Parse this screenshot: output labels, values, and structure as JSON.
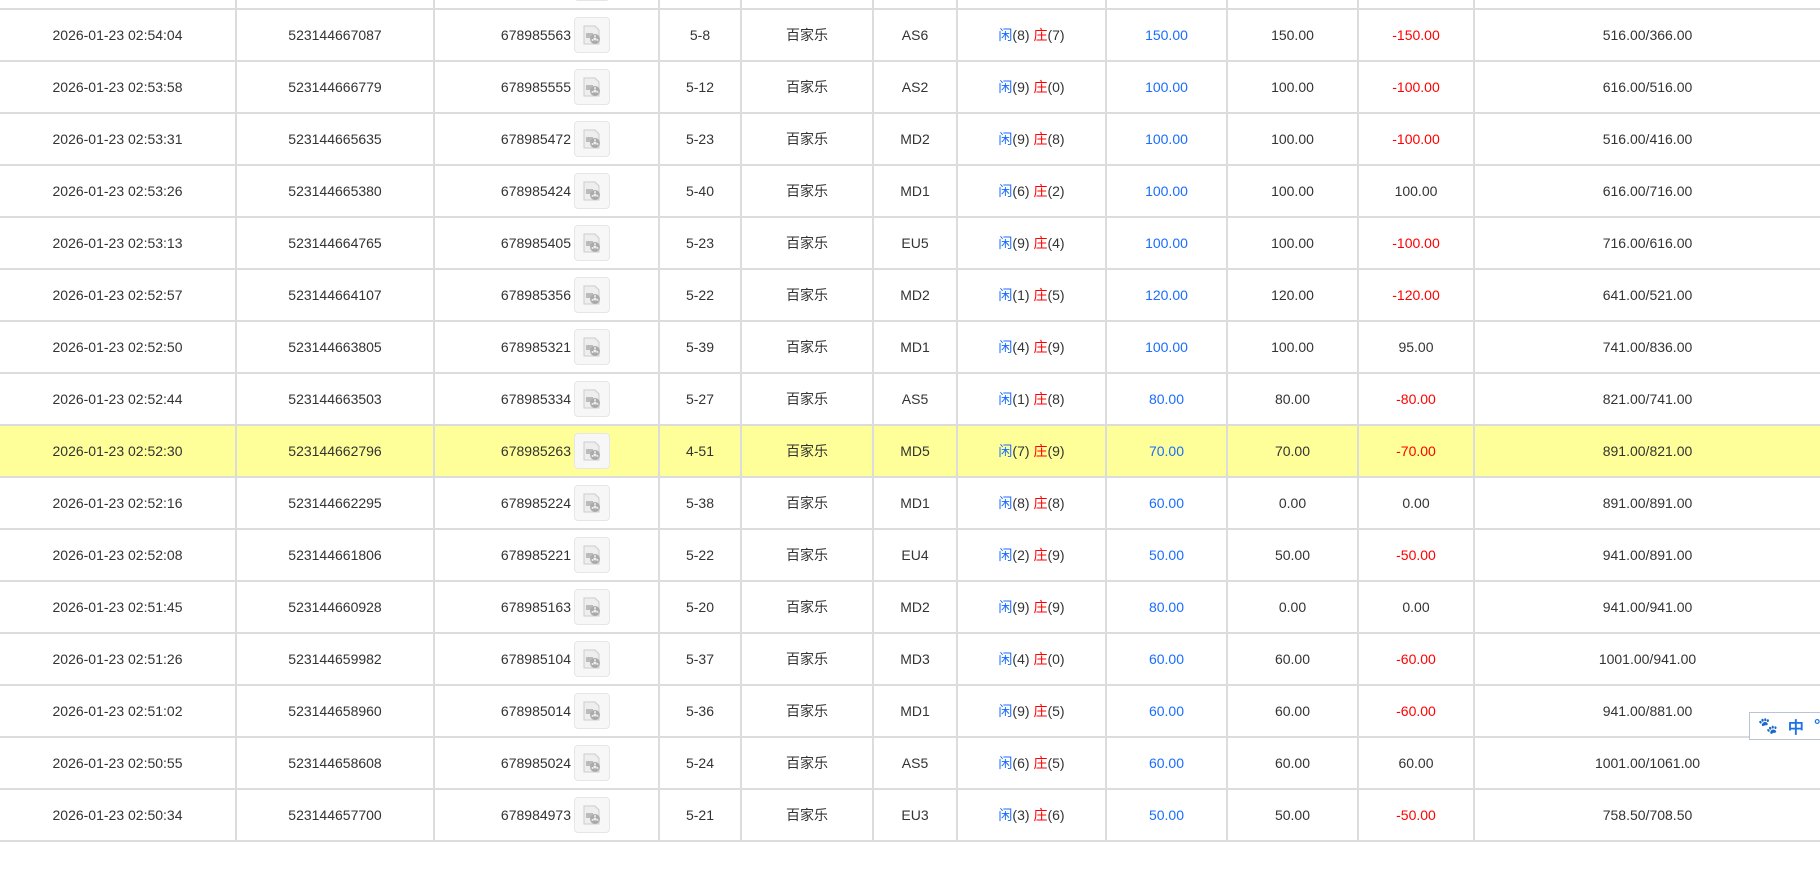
{
  "colors": {
    "blue": "#1a6dff",
    "red": "#ff0000",
    "highlight": "#ffff99"
  },
  "labels": {
    "player": "闲",
    "banker": "庄"
  },
  "ime": {
    "icon": "paw-icon",
    "mode": "中",
    "punct": "°,"
  },
  "highlighted_row": 9,
  "rows": [
    {
      "time": "",
      "order": "",
      "round": "",
      "shoe": "",
      "game": "",
      "table": "",
      "p": "",
      "b": "",
      "bet": "",
      "valid": "",
      "win": "",
      "balance": ""
    },
    {
      "time": "2026-01-23 02:54:04",
      "order": "523144667087",
      "round": "678985563",
      "shoe": "5-8",
      "game": "百家乐",
      "table": "AS6",
      "p": "8",
      "b": "7",
      "bet": "150.00",
      "valid": "150.00",
      "win": "-150.00",
      "balance": "516.00/366.00"
    },
    {
      "time": "2026-01-23 02:53:58",
      "order": "523144666779",
      "round": "678985555",
      "shoe": "5-12",
      "game": "百家乐",
      "table": "AS2",
      "p": "9",
      "b": "0",
      "bet": "100.00",
      "valid": "100.00",
      "win": "-100.00",
      "balance": "616.00/516.00"
    },
    {
      "time": "2026-01-23 02:53:31",
      "order": "523144665635",
      "round": "678985472",
      "shoe": "5-23",
      "game": "百家乐",
      "table": "MD2",
      "p": "9",
      "b": "8",
      "bet": "100.00",
      "valid": "100.00",
      "win": "-100.00",
      "balance": "516.00/416.00"
    },
    {
      "time": "2026-01-23 02:53:26",
      "order": "523144665380",
      "round": "678985424",
      "shoe": "5-40",
      "game": "百家乐",
      "table": "MD1",
      "p": "6",
      "b": "2",
      "bet": "100.00",
      "valid": "100.00",
      "win": "100.00",
      "balance": "616.00/716.00"
    },
    {
      "time": "2026-01-23 02:53:13",
      "order": "523144664765",
      "round": "678985405",
      "shoe": "5-23",
      "game": "百家乐",
      "table": "EU5",
      "p": "9",
      "b": "4",
      "bet": "100.00",
      "valid": "100.00",
      "win": "-100.00",
      "balance": "716.00/616.00"
    },
    {
      "time": "2026-01-23 02:52:57",
      "order": "523144664107",
      "round": "678985356",
      "shoe": "5-22",
      "game": "百家乐",
      "table": "MD2",
      "p": "1",
      "b": "5",
      "bet": "120.00",
      "valid": "120.00",
      "win": "-120.00",
      "balance": "641.00/521.00"
    },
    {
      "time": "2026-01-23 02:52:50",
      "order": "523144663805",
      "round": "678985321",
      "shoe": "5-39",
      "game": "百家乐",
      "table": "MD1",
      "p": "4",
      "b": "9",
      "bet": "100.00",
      "valid": "100.00",
      "win": "95.00",
      "balance": "741.00/836.00"
    },
    {
      "time": "2026-01-23 02:52:44",
      "order": "523144663503",
      "round": "678985334",
      "shoe": "5-27",
      "game": "百家乐",
      "table": "AS5",
      "p": "1",
      "b": "8",
      "bet": "80.00",
      "valid": "80.00",
      "win": "-80.00",
      "balance": "821.00/741.00"
    },
    {
      "time": "2026-01-23 02:52:30",
      "order": "523144662796",
      "round": "678985263",
      "shoe": "4-51",
      "game": "百家乐",
      "table": "MD5",
      "p": "7",
      "b": "9",
      "bet": "70.00",
      "valid": "70.00",
      "win": "-70.00",
      "balance": "891.00/821.00"
    },
    {
      "time": "2026-01-23 02:52:16",
      "order": "523144662295",
      "round": "678985224",
      "shoe": "5-38",
      "game": "百家乐",
      "table": "MD1",
      "p": "8",
      "b": "8",
      "bet": "60.00",
      "valid": "0.00",
      "win": "0.00",
      "balance": "891.00/891.00"
    },
    {
      "time": "2026-01-23 02:52:08",
      "order": "523144661806",
      "round": "678985221",
      "shoe": "5-22",
      "game": "百家乐",
      "table": "EU4",
      "p": "2",
      "b": "9",
      "bet": "50.00",
      "valid": "50.00",
      "win": "-50.00",
      "balance": "941.00/891.00"
    },
    {
      "time": "2026-01-23 02:51:45",
      "order": "523144660928",
      "round": "678985163",
      "shoe": "5-20",
      "game": "百家乐",
      "table": "MD2",
      "p": "9",
      "b": "9",
      "bet": "80.00",
      "valid": "0.00",
      "win": "0.00",
      "balance": "941.00/941.00"
    },
    {
      "time": "2026-01-23 02:51:26",
      "order": "523144659982",
      "round": "678985104",
      "shoe": "5-37",
      "game": "百家乐",
      "table": "MD3",
      "p": "4",
      "b": "0",
      "bet": "60.00",
      "valid": "60.00",
      "win": "-60.00",
      "balance": "1001.00/941.00"
    },
    {
      "time": "2026-01-23 02:51:02",
      "order": "523144658960",
      "round": "678985014",
      "shoe": "5-36",
      "game": "百家乐",
      "table": "MD1",
      "p": "9",
      "b": "5",
      "bet": "60.00",
      "valid": "60.00",
      "win": "-60.00",
      "balance": "941.00/881.00"
    },
    {
      "time": "2026-01-23 02:50:55",
      "order": "523144658608",
      "round": "678985024",
      "shoe": "5-24",
      "game": "百家乐",
      "table": "AS5",
      "p": "6",
      "b": "5",
      "bet": "60.00",
      "valid": "60.00",
      "win": "60.00",
      "balance": "1001.00/1061.00"
    },
    {
      "time": "2026-01-23 02:50:34",
      "order": "523144657700",
      "round": "678984973",
      "shoe": "5-21",
      "game": "百家乐",
      "table": "EU3",
      "p": "3",
      "b": "6",
      "bet": "50.00",
      "valid": "50.00",
      "win": "-50.00",
      "balance": "758.50/708.50"
    }
  ]
}
